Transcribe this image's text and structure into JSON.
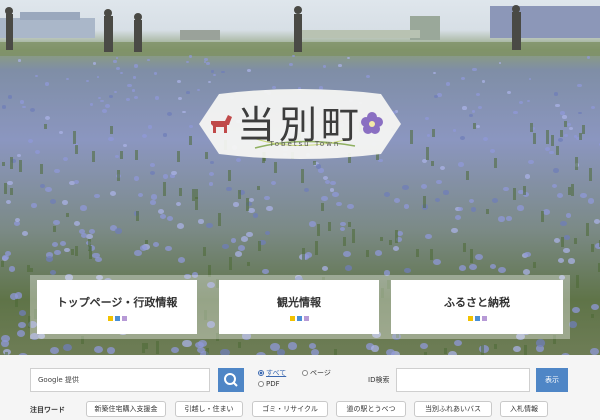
{
  "logo": {
    "title": "当別町",
    "subtitle": "Tobetsu Town"
  },
  "nav_cards": [
    {
      "label": "トップページ・行政情報"
    },
    {
      "label": "観光情報"
    },
    {
      "label": "ふるさと納税"
    }
  ],
  "card_dot_colors": [
    "#f2c200",
    "#4a8fd6",
    "#b79ad6"
  ],
  "search": {
    "placeholder": "Google 提供",
    "button_icon": "search-icon",
    "scope_options": [
      {
        "label": "すべて",
        "selected": true
      },
      {
        "label": "ページ",
        "selected": false
      },
      {
        "label": "PDF",
        "selected": false
      }
    ]
  },
  "id_search": {
    "label": "ID検索",
    "button_label": "表示"
  },
  "keywords": {
    "label": "注目ワード",
    "items": [
      "新築住宅購入支援金",
      "引越し・住まい",
      "ゴミ・リサイクル",
      "道の駅とうべつ",
      "当別ふれあいバス",
      "入札情報"
    ]
  },
  "colors": {
    "accent": "#4f86c6",
    "flower": "#8f98d8"
  }
}
